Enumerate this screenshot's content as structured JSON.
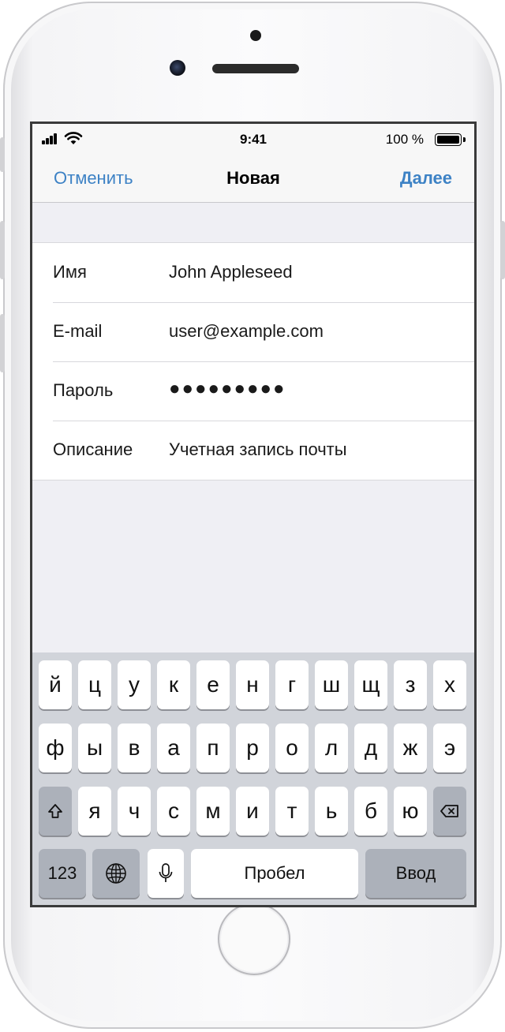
{
  "status_bar": {
    "time": "9:41",
    "battery": "100 %"
  },
  "nav": {
    "cancel": "Отменить",
    "title": "Новая",
    "next": "Далее"
  },
  "form": {
    "rows": [
      {
        "label": "Имя",
        "value": "John Appleseed"
      },
      {
        "label": "E-mail",
        "value": "user@example.com"
      },
      {
        "label": "Пароль",
        "value": "●●●●●●●●●"
      },
      {
        "label": "Описание",
        "value": "Учетная запись почты"
      }
    ]
  },
  "keyboard": {
    "row1": [
      "й",
      "ц",
      "у",
      "к",
      "е",
      "н",
      "г",
      "ш",
      "щ",
      "з",
      "х"
    ],
    "row2": [
      "ф",
      "ы",
      "в",
      "а",
      "п",
      "р",
      "о",
      "л",
      "д",
      "ж",
      "э"
    ],
    "row3": [
      "я",
      "ч",
      "с",
      "м",
      "и",
      "т",
      "ь",
      "б",
      "ю"
    ],
    "numbers": "123",
    "space": "Пробел",
    "return": "Ввод"
  },
  "colors": {
    "accent": "#3d82c5",
    "keyboard_bg": "#d1d4da",
    "function_key": "#acb1ba",
    "screen_bg": "#efeff4"
  }
}
